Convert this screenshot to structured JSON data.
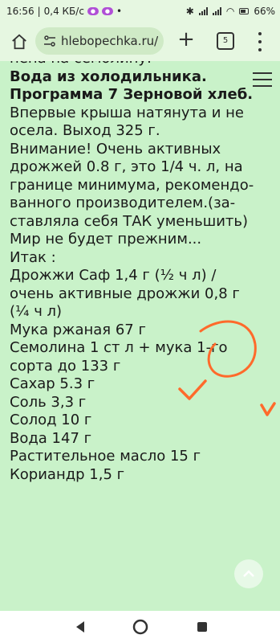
{
  "status_bar": {
    "time": "16:56",
    "speed": "0,4 КБ/с",
    "battery": "66"
  },
  "browser": {
    "url": "hlebopechka.ru/",
    "tab_count": "5"
  },
  "content": {
    "lines": [
      {
        "text": "нена на семолину.",
        "bold": false
      },
      {
        "text": "Вода из холодильника.",
        "bold": true
      },
      {
        "text": "Программа 7 Зерновой хлеб.",
        "bold": true
      },
      {
        "text": "Впервые крыша натянута и не",
        "bold": false
      },
      {
        "text": "осела. Выход 325 г.",
        "bold": false
      },
      {
        "text": "Внимание! Очень активных",
        "bold": false
      },
      {
        "text": "дрожжей 0.8 г, это 1/4 ч. л, на",
        "bold": false
      },
      {
        "text": "границе минимума, рекомендо-",
        "bold": false
      },
      {
        "text": "ванного производителем.(за-",
        "bold": false
      },
      {
        "text": "ставляла себя ТАК уменьшить)",
        "bold": false
      },
      {
        "text": "Мир не будет прежним...",
        "bold": false
      },
      {
        "text": "Итак :",
        "bold": false
      },
      {
        "text": "Дрожжи Саф 1,4 г (½ ч л) /",
        "bold": false
      },
      {
        "text": "очень активные дрожжи 0,8 г",
        "bold": false
      },
      {
        "text": "(¼ ч л)",
        "bold": false
      },
      {
        "text": "Мука ржаная 67 г",
        "bold": false
      },
      {
        "text": "Семолина 1 ст л + мука 1-го",
        "bold": false
      },
      {
        "text": "сорта до 133 г",
        "bold": false
      },
      {
        "text": "Сахар 5.3 г",
        "bold": false
      },
      {
        "text": "Соль 3,3 г",
        "bold": false
      },
      {
        "text": "Солод 10 г",
        "bold": false
      },
      {
        "text": "Вода 147 г",
        "bold": false
      },
      {
        "text": "Растительное масло 15 г",
        "bold": false
      },
      {
        "text": "Кориандр 1,5 г",
        "bold": false
      }
    ]
  },
  "colors": {
    "content_bg": "#c9f2c9",
    "annotation": "#ff6a2b"
  }
}
